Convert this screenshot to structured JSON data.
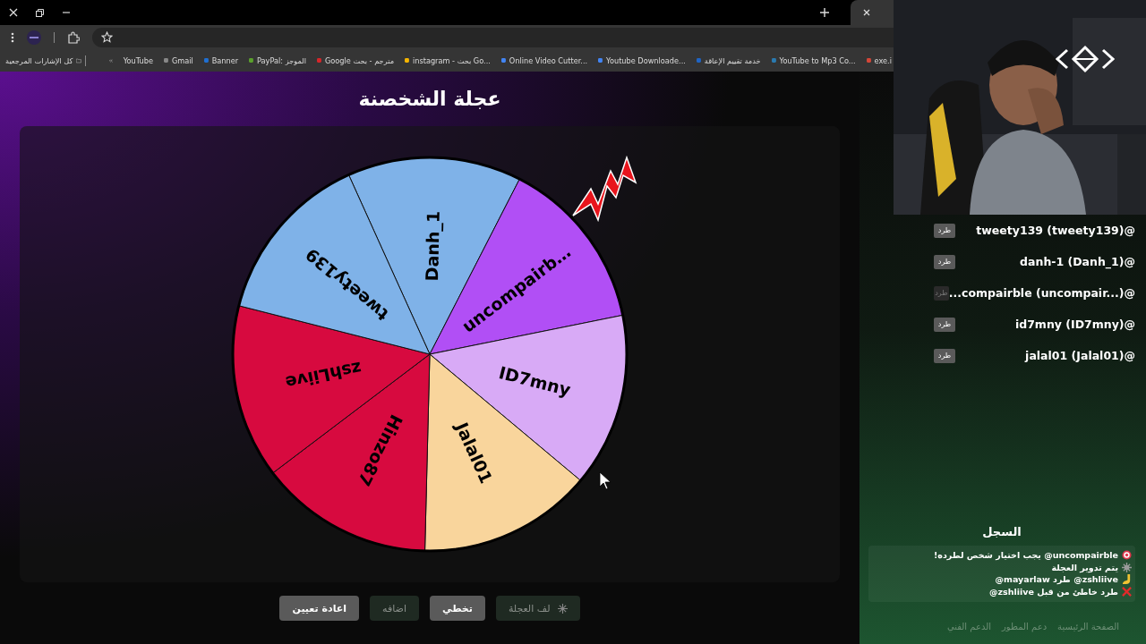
{
  "bookmarks_bar": {
    "all_bookmarks": "كل الإشارات المرجعية",
    "items": [
      {
        "label": "exe.i"
      },
      {
        "label": "YouTube to Mp3 Co..."
      },
      {
        "label": "خدمة تقييم الإعاقة"
      },
      {
        "label": "Youtube Downloade..."
      },
      {
        "label": "Online Video Cutter..."
      },
      {
        "label": "instagram - بحث Go..."
      },
      {
        "label": "مترجم - بحث Google"
      },
      {
        "label": "PayPal: الموجز"
      },
      {
        "label": "Banner"
      },
      {
        "label": "Gmail"
      },
      {
        "label": "YouTube"
      }
    ]
  },
  "page": {
    "title": "عجلة الشخصنة",
    "wheel": {
      "segments": [
        {
          "label": "Danh_1",
          "color": "#7fb2e8"
        },
        {
          "label": "uncompairb…",
          "color": "#b14ff5"
        },
        {
          "label": "ID7mny",
          "color": "#d8aaf6"
        },
        {
          "label": "Jalal01",
          "color": "#f9d59c"
        },
        {
          "label": "Hinzo87",
          "color": "#d70a3f"
        },
        {
          "label": "zshLiive",
          "color": "#d70a3f"
        },
        {
          "label": "tweety139",
          "color": "#7fb2e8"
        }
      ]
    },
    "buttons": [
      {
        "kind": "spin",
        "label": "لف العجلة",
        "disabled": true
      },
      {
        "kind": "plain",
        "label": "تخطي",
        "disabled": false
      },
      {
        "kind": "plain",
        "label": "اضافه",
        "disabled": true
      },
      {
        "kind": "plain",
        "label": "اعادة تعيين",
        "disabled": false
      }
    ],
    "players": [
      {
        "label": "tweety139 (tweety139)@",
        "kick": {
          "label": "طرد",
          "disabled": false
        }
      },
      {
        "label": "danh-1 (Danh_1)@",
        "kick": {
          "label": "طرد",
          "disabled": false
        }
      },
      {
        "label": "...compairble (uncompair...)@",
        "kick": {
          "label": "طرد",
          "disabled": true
        }
      },
      {
        "label": "id7mny (ID7mny)@",
        "kick": {
          "label": "طرد",
          "disabled": false
        }
      },
      {
        "label": "jalal01 (Jalal01)@",
        "kick": {
          "label": "طرد",
          "disabled": false
        }
      }
    ],
    "log": {
      "title": "السجل",
      "entries": [
        {
          "kind": "target",
          "text": "uncompairble@ يجب اختيار شخص لطرده!"
        },
        {
          "kind": "spin",
          "text": "يتم تدوير العجلة"
        },
        {
          "kind": "kick",
          "text": "zshliive@ طرد mayarlaw@"
        },
        {
          "kind": "wrong",
          "text": "طرد خاطئ من قبل zshliive@"
        }
      ]
    },
    "footer_links": [
      "الصفحة الرئيسية",
      "دعم المطور",
      "الدعم الفني"
    ]
  }
}
